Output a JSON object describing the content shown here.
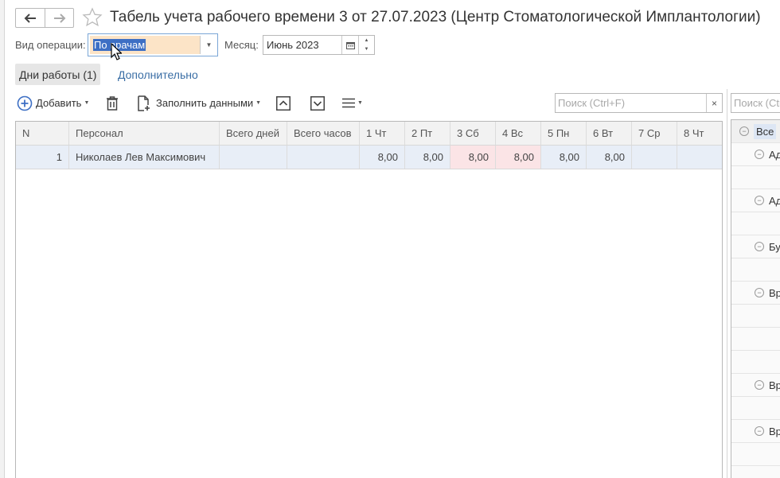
{
  "window": {
    "title": "Табель учета рабочего времени 3 от 27.07.2023 (Центр Стоматологической Имплантологии)"
  },
  "form": {
    "operation_label": "Вид операции:",
    "operation_value": "По врачам",
    "month_label": "Месяц:",
    "month_value": "Июнь 2023"
  },
  "tabs": [
    {
      "label": "Дни работы (1)",
      "active": true
    },
    {
      "label": "Дополнительно",
      "active": false
    }
  ],
  "toolbar": {
    "add_label": "Добавить",
    "fill_label": "Заполнить данными",
    "search_placeholder": "Поиск (Ctrl+F)",
    "search_clear": "×"
  },
  "table": {
    "columns": [
      "N",
      "Персонал",
      "Всего дней",
      "Всего часов",
      "1 Чт",
      "2 Пт",
      "3 Сб",
      "4 Вс",
      "5 Пн",
      "6 Вт",
      "7 Ср",
      "8 Чт"
    ],
    "rows": [
      {
        "n": "1",
        "person": "Николаев Лев Максимович",
        "total_days": "",
        "total_hours": "",
        "days": [
          "8,00",
          "8,00",
          "8,00",
          "8,00",
          "8,00",
          "8,00",
          "",
          ""
        ]
      }
    ]
  },
  "right_panel": {
    "search_placeholder": "Поиск (Ctrl+F)",
    "root_label": "Все",
    "groups": [
      "Ад",
      "Ад",
      "Бу",
      "Вр",
      "Вр",
      "Вр"
    ]
  },
  "colors": {
    "accent_blue": "#3d6fc4",
    "link": "#3a6ea5",
    "weekend_cell": "#fbe4e6",
    "selected_row": "#e8eef7",
    "combo_fill": "#fce4c7"
  }
}
